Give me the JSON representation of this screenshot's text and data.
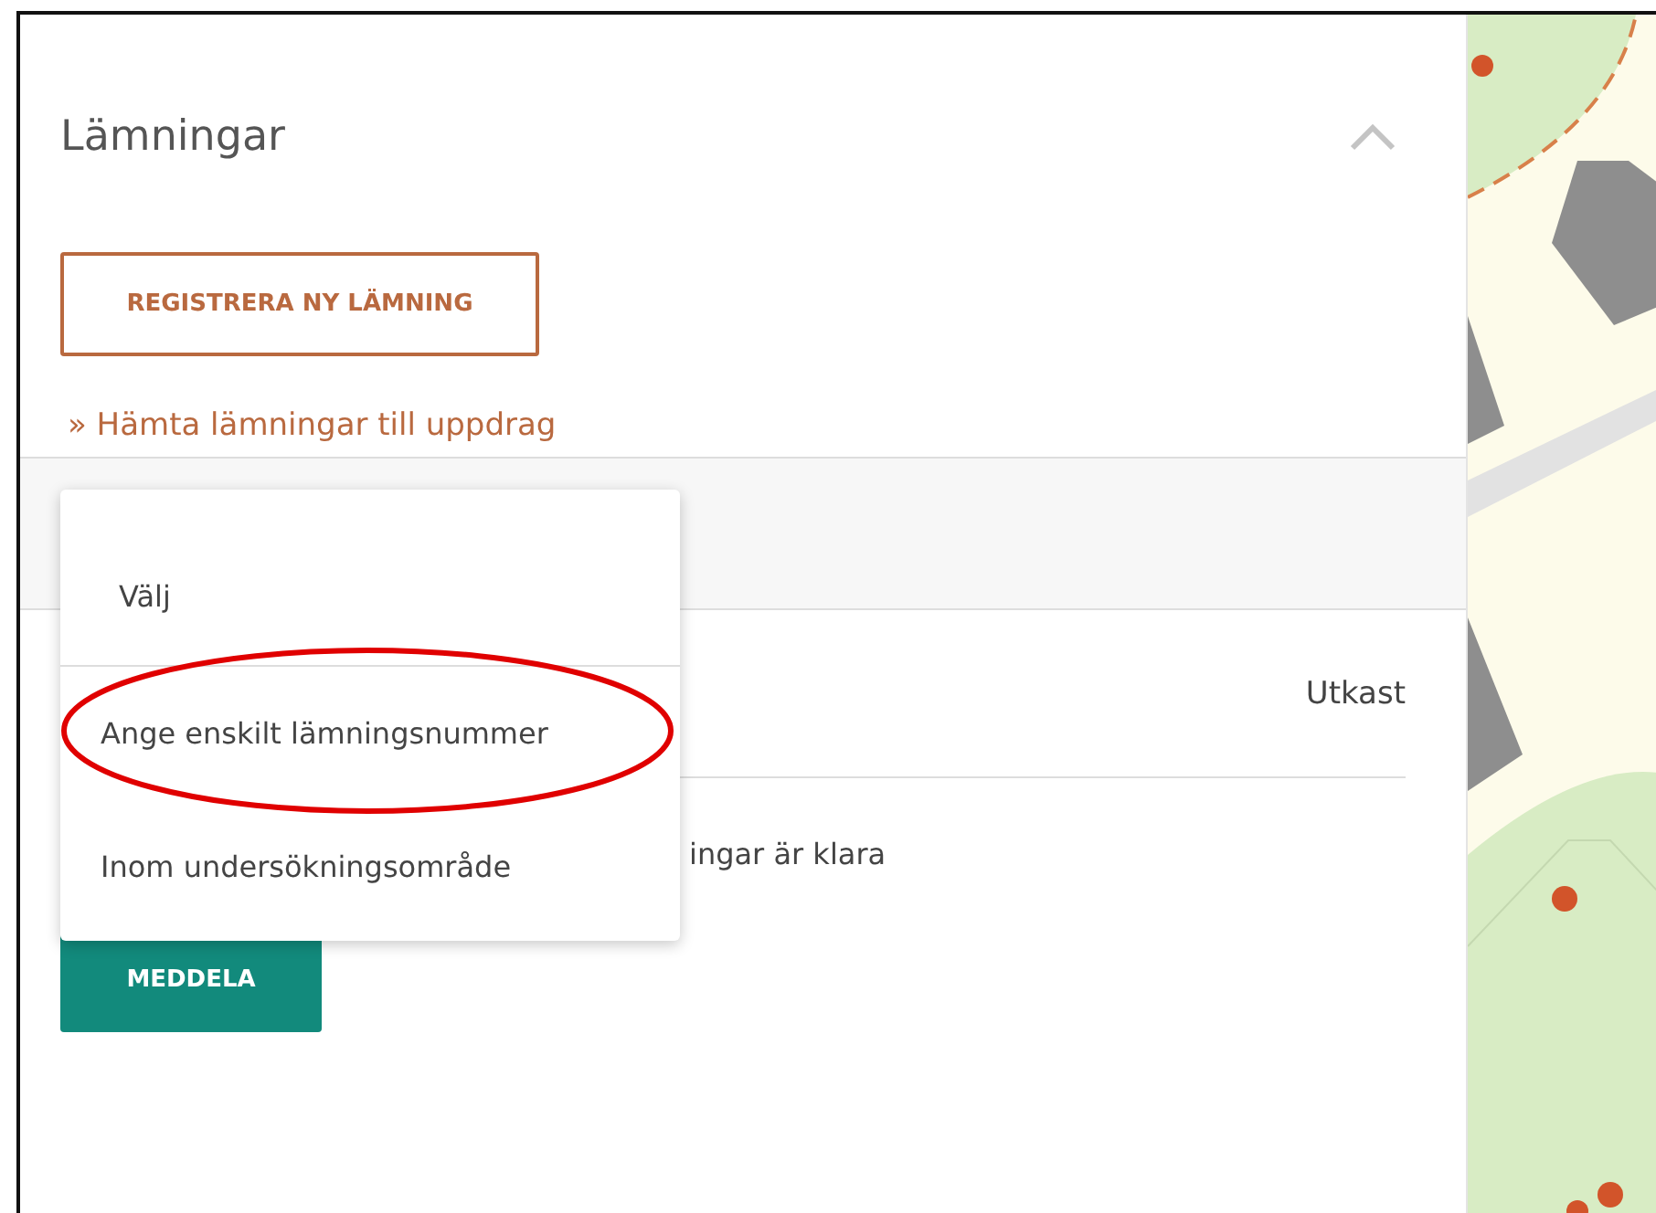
{
  "panel": {
    "title": "Lämningar",
    "expanded": true
  },
  "register_button": "REGISTRERA NY LÄMNING",
  "fetch_link": {
    "marker": "»",
    "label": "Hämta lämningar till uppdrag"
  },
  "dropdown": {
    "open": true,
    "items": [
      {
        "label": "Välj",
        "kind": "placeholder"
      },
      {
        "label": "Ange enskilt lämningsnummer",
        "kind": "option"
      },
      {
        "label": "Inom undersökningsområde",
        "kind": "option"
      }
    ]
  },
  "status": "Utkast",
  "notify_text": "ingar är klara",
  "notify_button": "MEDDELA"
}
